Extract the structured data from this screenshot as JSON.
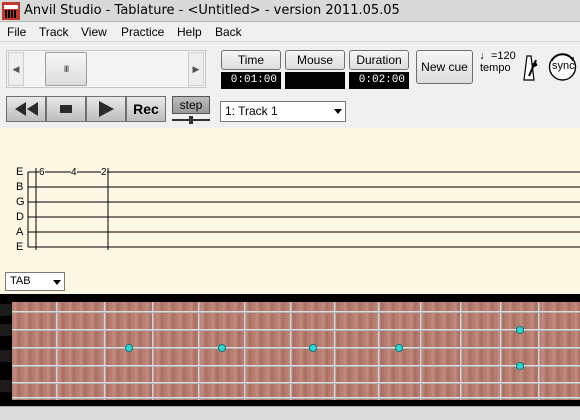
{
  "window": {
    "title": "Anvil Studio - Tablature - <Untitled> - version 2011.05.05"
  },
  "menu": [
    "File",
    "Track",
    "View",
    "Practice",
    "Help",
    "Back"
  ],
  "scrollbar": {
    "thumb_glyph": "III"
  },
  "time_display": {
    "time_label": "Time",
    "mouse_label": "Mouse",
    "duration_label": "Duration",
    "time_value": "0:01:00",
    "mouse_value": "",
    "duration_value": "0:02:00"
  },
  "buttons": {
    "new_cue": "New cue",
    "tempo_value": "♩=120",
    "tempo_label": "tempo",
    "sync": "sync",
    "rec": "Rec",
    "step": "step"
  },
  "track_select": {
    "selected": "1: Track 1"
  },
  "tablature": {
    "strings": [
      "E",
      "B",
      "G",
      "D",
      "A",
      "E"
    ],
    "fret_numbers": [
      "6",
      "4",
      "2"
    ]
  },
  "view_select": {
    "selected": "TAB"
  },
  "icons": {
    "rewind": "rewind-icon",
    "stop": "stop-icon",
    "play": "play-icon",
    "metronome": "metronome-icon",
    "sync": "sync-icon",
    "app": "anvil-app-icon"
  },
  "colors": {
    "tab_background": "#fdf8e3",
    "fret_dot": "#33d6d6",
    "fretboard_wood": "#b37a6c"
  }
}
